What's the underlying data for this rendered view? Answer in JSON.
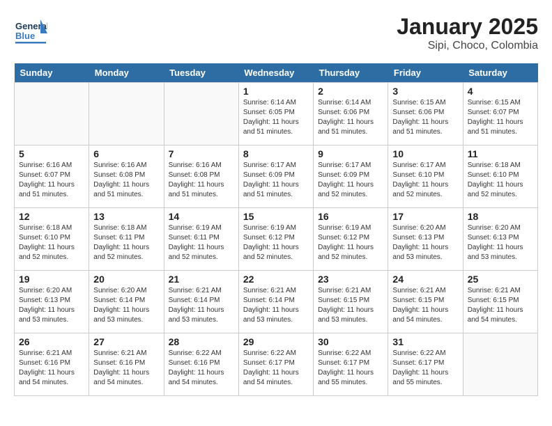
{
  "header": {
    "logo_general": "General",
    "logo_blue": "Blue",
    "month_title": "January 2025",
    "subtitle": "Sipi, Choco, Colombia"
  },
  "days_of_week": [
    "Sunday",
    "Monday",
    "Tuesday",
    "Wednesday",
    "Thursday",
    "Friday",
    "Saturday"
  ],
  "weeks": [
    [
      {
        "num": "",
        "sunrise": "",
        "sunset": "",
        "daylight": "",
        "empty": true
      },
      {
        "num": "",
        "sunrise": "",
        "sunset": "",
        "daylight": "",
        "empty": true
      },
      {
        "num": "",
        "sunrise": "",
        "sunset": "",
        "daylight": "",
        "empty": true
      },
      {
        "num": "1",
        "sunrise": "Sunrise: 6:14 AM",
        "sunset": "Sunset: 6:05 PM",
        "daylight": "Daylight: 11 hours and 51 minutes."
      },
      {
        "num": "2",
        "sunrise": "Sunrise: 6:14 AM",
        "sunset": "Sunset: 6:06 PM",
        "daylight": "Daylight: 11 hours and 51 minutes."
      },
      {
        "num": "3",
        "sunrise": "Sunrise: 6:15 AM",
        "sunset": "Sunset: 6:06 PM",
        "daylight": "Daylight: 11 hours and 51 minutes."
      },
      {
        "num": "4",
        "sunrise": "Sunrise: 6:15 AM",
        "sunset": "Sunset: 6:07 PM",
        "daylight": "Daylight: 11 hours and 51 minutes."
      }
    ],
    [
      {
        "num": "5",
        "sunrise": "Sunrise: 6:16 AM",
        "sunset": "Sunset: 6:07 PM",
        "daylight": "Daylight: 11 hours and 51 minutes."
      },
      {
        "num": "6",
        "sunrise": "Sunrise: 6:16 AM",
        "sunset": "Sunset: 6:08 PM",
        "daylight": "Daylight: 11 hours and 51 minutes."
      },
      {
        "num": "7",
        "sunrise": "Sunrise: 6:16 AM",
        "sunset": "Sunset: 6:08 PM",
        "daylight": "Daylight: 11 hours and 51 minutes."
      },
      {
        "num": "8",
        "sunrise": "Sunrise: 6:17 AM",
        "sunset": "Sunset: 6:09 PM",
        "daylight": "Daylight: 11 hours and 51 minutes."
      },
      {
        "num": "9",
        "sunrise": "Sunrise: 6:17 AM",
        "sunset": "Sunset: 6:09 PM",
        "daylight": "Daylight: 11 hours and 52 minutes."
      },
      {
        "num": "10",
        "sunrise": "Sunrise: 6:17 AM",
        "sunset": "Sunset: 6:10 PM",
        "daylight": "Daylight: 11 hours and 52 minutes."
      },
      {
        "num": "11",
        "sunrise": "Sunrise: 6:18 AM",
        "sunset": "Sunset: 6:10 PM",
        "daylight": "Daylight: 11 hours and 52 minutes."
      }
    ],
    [
      {
        "num": "12",
        "sunrise": "Sunrise: 6:18 AM",
        "sunset": "Sunset: 6:10 PM",
        "daylight": "Daylight: 11 hours and 52 minutes."
      },
      {
        "num": "13",
        "sunrise": "Sunrise: 6:18 AM",
        "sunset": "Sunset: 6:11 PM",
        "daylight": "Daylight: 11 hours and 52 minutes."
      },
      {
        "num": "14",
        "sunrise": "Sunrise: 6:19 AM",
        "sunset": "Sunset: 6:11 PM",
        "daylight": "Daylight: 11 hours and 52 minutes."
      },
      {
        "num": "15",
        "sunrise": "Sunrise: 6:19 AM",
        "sunset": "Sunset: 6:12 PM",
        "daylight": "Daylight: 11 hours and 52 minutes."
      },
      {
        "num": "16",
        "sunrise": "Sunrise: 6:19 AM",
        "sunset": "Sunset: 6:12 PM",
        "daylight": "Daylight: 11 hours and 52 minutes."
      },
      {
        "num": "17",
        "sunrise": "Sunrise: 6:20 AM",
        "sunset": "Sunset: 6:13 PM",
        "daylight": "Daylight: 11 hours and 53 minutes."
      },
      {
        "num": "18",
        "sunrise": "Sunrise: 6:20 AM",
        "sunset": "Sunset: 6:13 PM",
        "daylight": "Daylight: 11 hours and 53 minutes."
      }
    ],
    [
      {
        "num": "19",
        "sunrise": "Sunrise: 6:20 AM",
        "sunset": "Sunset: 6:13 PM",
        "daylight": "Daylight: 11 hours and 53 minutes."
      },
      {
        "num": "20",
        "sunrise": "Sunrise: 6:20 AM",
        "sunset": "Sunset: 6:14 PM",
        "daylight": "Daylight: 11 hours and 53 minutes."
      },
      {
        "num": "21",
        "sunrise": "Sunrise: 6:21 AM",
        "sunset": "Sunset: 6:14 PM",
        "daylight": "Daylight: 11 hours and 53 minutes."
      },
      {
        "num": "22",
        "sunrise": "Sunrise: 6:21 AM",
        "sunset": "Sunset: 6:14 PM",
        "daylight": "Daylight: 11 hours and 53 minutes."
      },
      {
        "num": "23",
        "sunrise": "Sunrise: 6:21 AM",
        "sunset": "Sunset: 6:15 PM",
        "daylight": "Daylight: 11 hours and 53 minutes."
      },
      {
        "num": "24",
        "sunrise": "Sunrise: 6:21 AM",
        "sunset": "Sunset: 6:15 PM",
        "daylight": "Daylight: 11 hours and 54 minutes."
      },
      {
        "num": "25",
        "sunrise": "Sunrise: 6:21 AM",
        "sunset": "Sunset: 6:15 PM",
        "daylight": "Daylight: 11 hours and 54 minutes."
      }
    ],
    [
      {
        "num": "26",
        "sunrise": "Sunrise: 6:21 AM",
        "sunset": "Sunset: 6:16 PM",
        "daylight": "Daylight: 11 hours and 54 minutes."
      },
      {
        "num": "27",
        "sunrise": "Sunrise: 6:21 AM",
        "sunset": "Sunset: 6:16 PM",
        "daylight": "Daylight: 11 hours and 54 minutes."
      },
      {
        "num": "28",
        "sunrise": "Sunrise: 6:22 AM",
        "sunset": "Sunset: 6:16 PM",
        "daylight": "Daylight: 11 hours and 54 minutes."
      },
      {
        "num": "29",
        "sunrise": "Sunrise: 6:22 AM",
        "sunset": "Sunset: 6:17 PM",
        "daylight": "Daylight: 11 hours and 54 minutes."
      },
      {
        "num": "30",
        "sunrise": "Sunrise: 6:22 AM",
        "sunset": "Sunset: 6:17 PM",
        "daylight": "Daylight: 11 hours and 55 minutes."
      },
      {
        "num": "31",
        "sunrise": "Sunrise: 6:22 AM",
        "sunset": "Sunset: 6:17 PM",
        "daylight": "Daylight: 11 hours and 55 minutes."
      },
      {
        "num": "",
        "sunrise": "",
        "sunset": "",
        "daylight": "",
        "empty": true
      }
    ]
  ]
}
